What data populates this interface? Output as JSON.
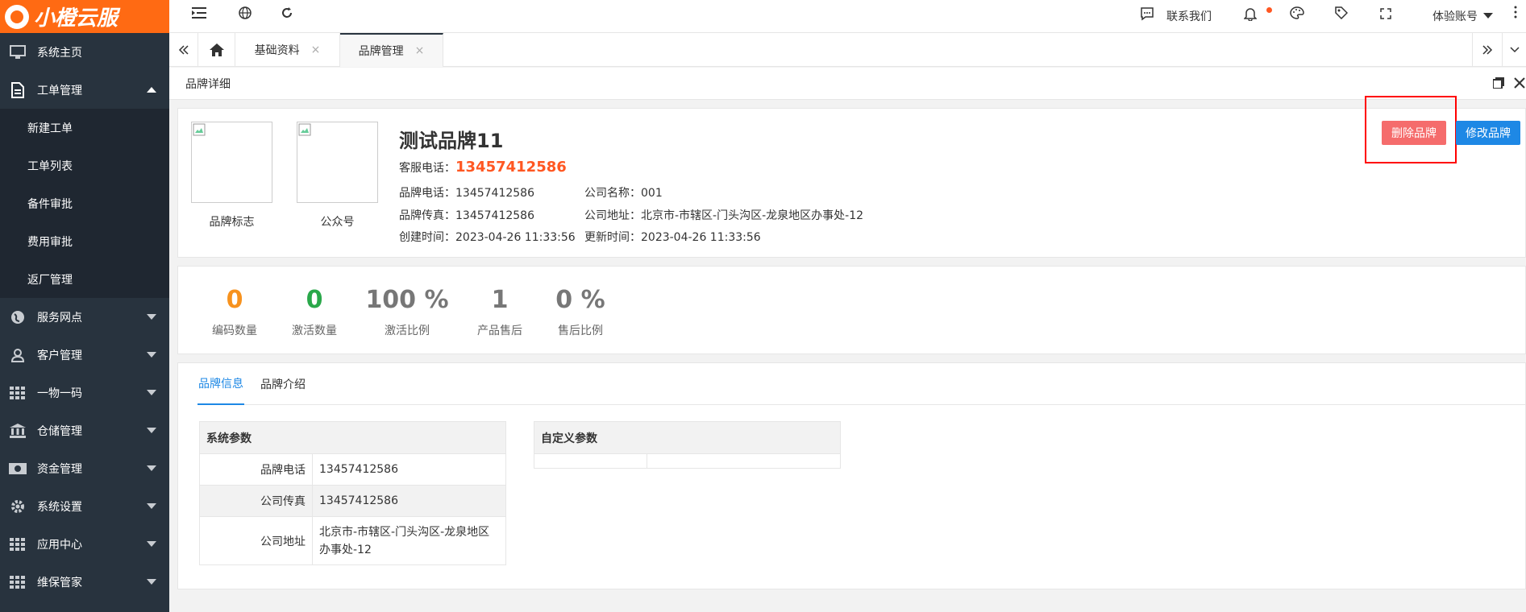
{
  "brand_logo_text": "小橙云服",
  "sidebar": {
    "items": [
      {
        "label": "系统主页",
        "icon": "monitor-icon"
      },
      {
        "label": "工单管理",
        "icon": "document-icon"
      },
      {
        "label": "服务网点",
        "icon": "globe-icon"
      },
      {
        "label": "客户管理",
        "icon": "user-icon"
      },
      {
        "label": "一物一码",
        "icon": "grid-icon"
      },
      {
        "label": "仓储管理",
        "icon": "bank-icon"
      },
      {
        "label": "资金管理",
        "icon": "money-icon"
      },
      {
        "label": "系统设置",
        "icon": "gear-icon"
      },
      {
        "label": "应用中心",
        "icon": "grid-icon"
      },
      {
        "label": "维保管家",
        "icon": "grid-icon"
      }
    ],
    "subitems": [
      "新建工单",
      "工单列表",
      "备件审批",
      "费用审批",
      "返厂管理"
    ]
  },
  "topbar": {
    "contact": "联系我们",
    "account": "体验账号"
  },
  "tabs": [
    {
      "label": "基础资料"
    },
    {
      "label": "品牌管理"
    }
  ],
  "breadcrumb": "品牌详细",
  "brand": {
    "logo_label": "品牌标志",
    "qr_label": "公众号",
    "name": "测试品牌11",
    "service_phone_label": "客服电话：",
    "service_phone": "13457412586",
    "brand_phone_label": "品牌电话：",
    "brand_phone": "13457412586",
    "company_name_label": "公司名称：",
    "company_name": "001",
    "brand_fax_label": "品牌传真：",
    "brand_fax": "13457412586",
    "company_address_label": "公司地址：",
    "company_address": "北京市-市辖区-门头沟区-龙泉地区办事处-12",
    "created_label": "创建时间：",
    "created": "2023-04-26 11:33:56",
    "updated_label": "更新时间：",
    "updated": "2023-04-26 11:33:56",
    "delete_button": "删除品牌",
    "edit_button": "修改品牌"
  },
  "stats": [
    {
      "value": "0",
      "label": "编码数量",
      "color": "#f7921e"
    },
    {
      "value": "0",
      "label": "激活数量",
      "color": "#2aa84a"
    },
    {
      "value": "100 %",
      "label": "激活比例",
      "color": "#777777"
    },
    {
      "value": "1",
      "label": "产品售后",
      "color": "#777777"
    },
    {
      "value": "0 %",
      "label": "售后比例",
      "color": "#777777"
    }
  ],
  "info_tabs": [
    {
      "label": "品牌信息"
    },
    {
      "label": "品牌介绍"
    }
  ],
  "system_params": {
    "title": "系统参数",
    "rows": [
      {
        "key": "品牌电话",
        "value": "13457412586"
      },
      {
        "key": "公司传真",
        "value": "13457412586"
      },
      {
        "key": "公司地址",
        "value": "北京市-市辖区-门头沟区-龙泉地区办事处-12"
      }
    ]
  },
  "custom_params": {
    "title": "自定义参数"
  },
  "colors": {
    "sidebar_bg": "#28333e",
    "brand_orange": "#ff6a13",
    "accent_blue": "#1e88e5",
    "danger_red": "#f56c6c",
    "phone_orange": "#ff5722"
  }
}
